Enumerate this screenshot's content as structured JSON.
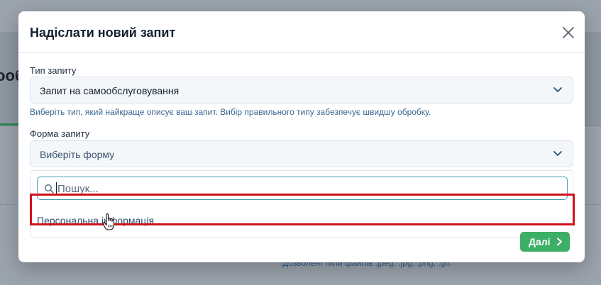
{
  "background": {
    "page_title_fragment": "ooб",
    "allowed_types_text": "Дозволені типи файлів .jpeg, .jpg, .png, .gif."
  },
  "modal": {
    "title": "Надіслати новий запит",
    "close_icon": "close-icon",
    "request_type": {
      "label": "Тип запиту",
      "value": "Запит на самообслуговування",
      "help": "Виберіть тип, який найкраще описує ваш запит. Вибір правильного типу забезпечує швидшу обробку."
    },
    "request_form": {
      "label": "Форма запиту",
      "placeholder": "Виберіть форму",
      "search_placeholder": "Пошук...",
      "search_value": "",
      "options": [
        "Персональна інформація"
      ]
    },
    "next_label": "Далі",
    "next_icon": "chevron-right-icon"
  },
  "colors": {
    "accent_green": "#3cae66",
    "highlight_red": "#d0121b",
    "focus_blue": "#4a9dbb"
  }
}
